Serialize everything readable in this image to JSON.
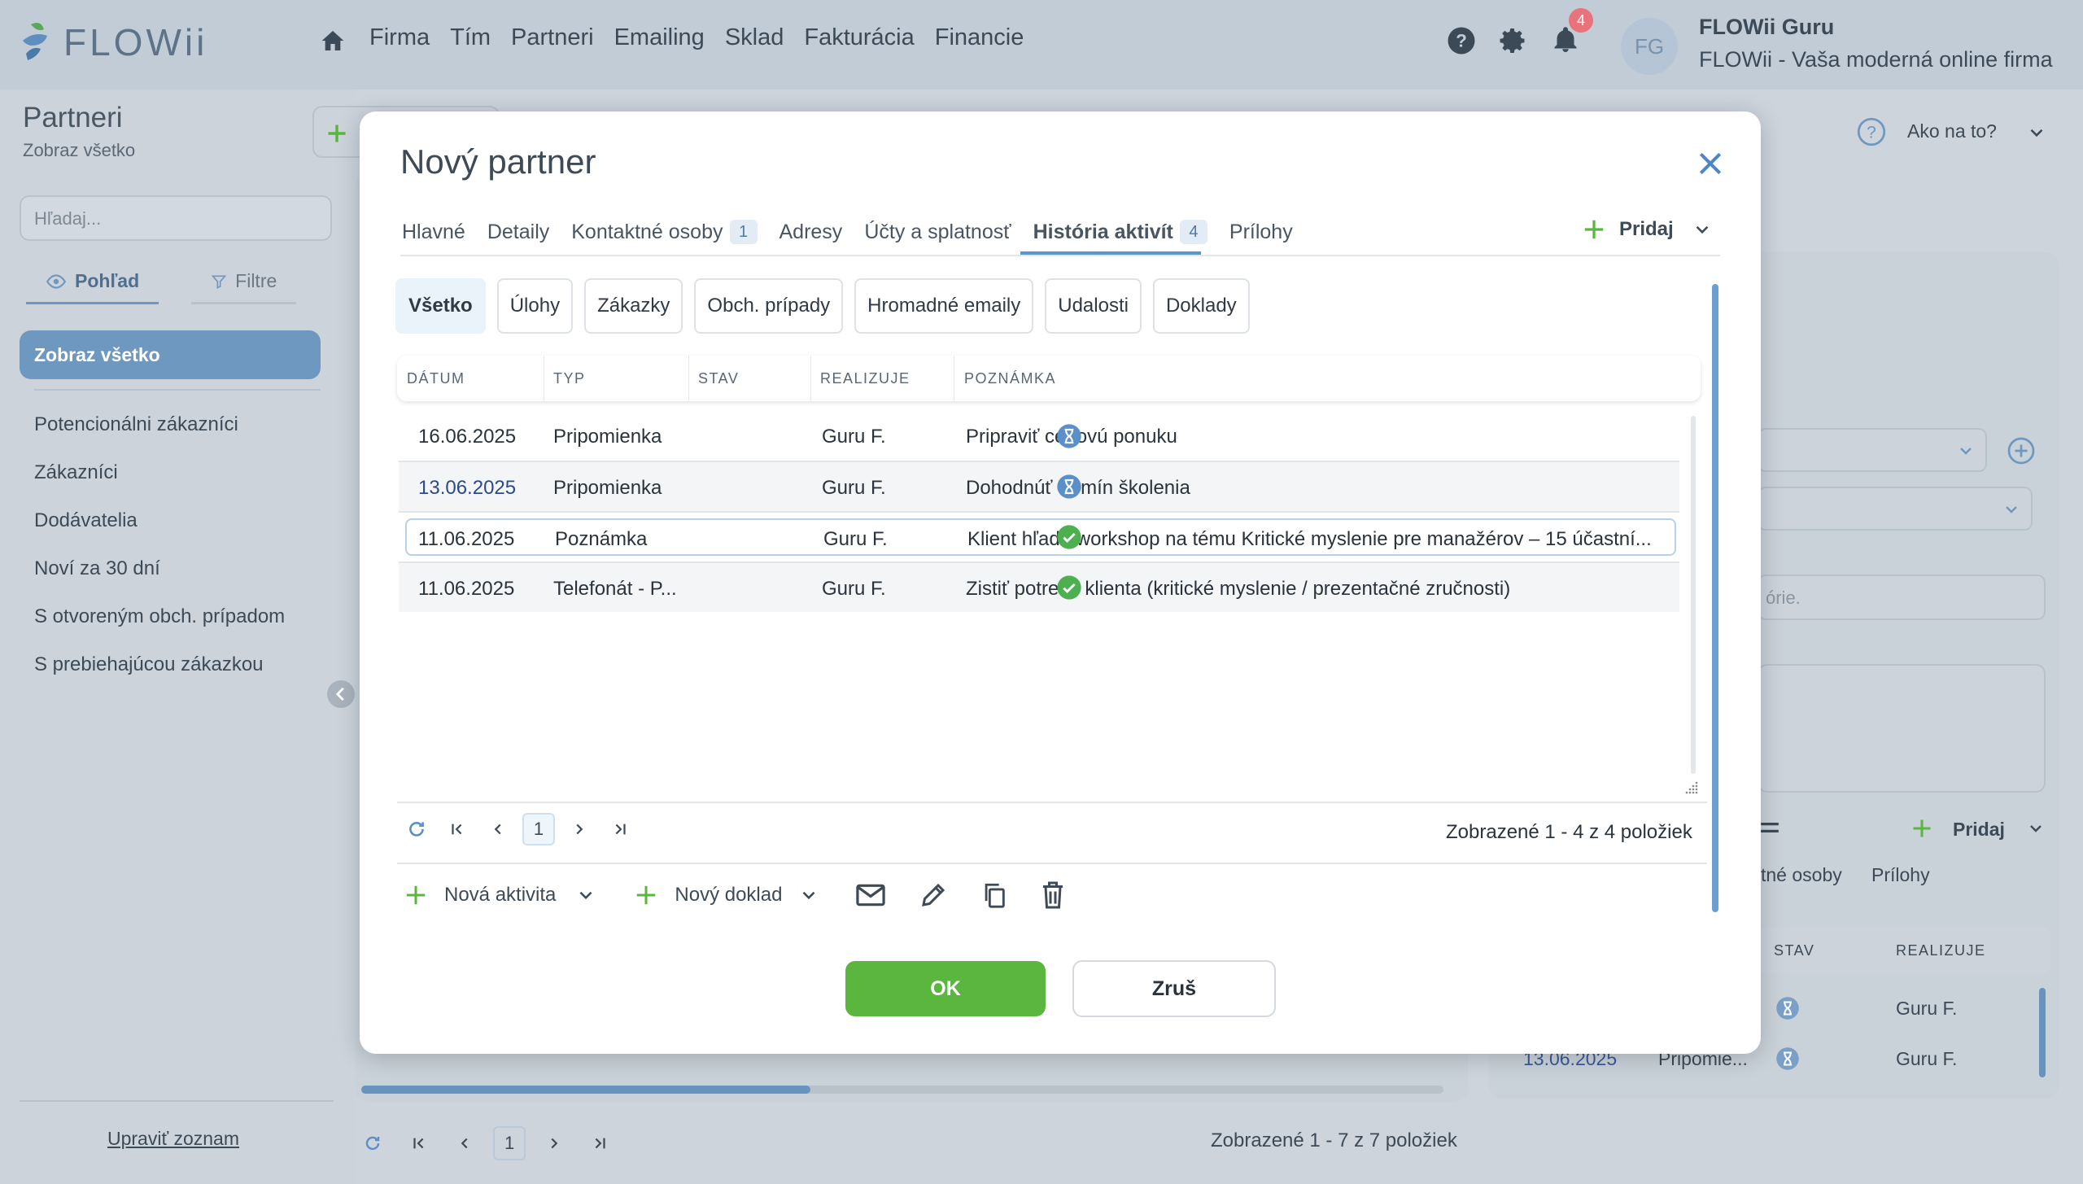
{
  "header": {
    "logo_text": "FLOWii",
    "nav": [
      "Firma",
      "Tím",
      "Partneri",
      "Emailing",
      "Sklad",
      "Fakturácia",
      "Financie"
    ],
    "notification_count": "4",
    "avatar_initials": "FG",
    "user_name": "FLOWii Guru",
    "company": "FLOWii - Vaša moderná online firma"
  },
  "sidebar": {
    "title": "Partneri",
    "subtitle": "Zobraz všetko",
    "search_placeholder": "Hľadaj...",
    "tab_view": "Pohľad",
    "tab_filters": "Filtre",
    "selected": "Zobraz všetko",
    "items": [
      "Potencionálni zákazníci",
      "Zákazníci",
      "Dodávatelia",
      "Noví za 30 dní",
      "S otvoreným obch. prípadom",
      "S prebiehajúcou zákazkou"
    ],
    "edit_link": "Upraviť zoznam"
  },
  "background": {
    "help_label": "Ako na to?",
    "pager_page": "1",
    "status": "Zobrazené 1 - 7 z 7 položiek",
    "right_panel": {
      "search_placeholder_fragment": "órie.",
      "pridaj": "Pridaj",
      "tab_fragment": "tné osoby",
      "tab_attachments": "Prílohy",
      "col_stav": "STAV",
      "col_realizuje": "REALIZUJE",
      "row1_realizuje": "Guru F.",
      "row2_date": "13.06.2025",
      "row2_type": "Pripomie...",
      "row2_realizuje": "Guru F."
    }
  },
  "modal": {
    "title": "Nový partner",
    "tabs": [
      {
        "label": "Hlavné",
        "count": ""
      },
      {
        "label": "Detaily",
        "count": ""
      },
      {
        "label": "Kontaktné osoby",
        "count": "1"
      },
      {
        "label": "Adresy",
        "count": ""
      },
      {
        "label": "Účty a splatnosť",
        "count": ""
      },
      {
        "label": "História aktivít",
        "count": "4"
      },
      {
        "label": "Prílohy",
        "count": ""
      }
    ],
    "active_tab": "História aktivít",
    "pridaj_label": "Pridaj",
    "filters": [
      "Všetko",
      "Úlohy",
      "Zákazky",
      "Obch. prípady",
      "Hromadné emaily",
      "Udalosti",
      "Doklady"
    ],
    "active_filter": "Všetko",
    "columns": [
      "DÁTUM",
      "TYP",
      "STAV",
      "REALIZUJE",
      "POZNÁMKA"
    ],
    "rows": [
      {
        "date": "16.06.2025",
        "type": "Pripomienka",
        "status": "pending",
        "by": "Guru F.",
        "note": "Pripraviť cenovú ponuku"
      },
      {
        "date": "13.06.2025",
        "type": "Pripomienka",
        "status": "pending",
        "by": "Guru F.",
        "note": "Dohodnúť termín školenia"
      },
      {
        "date": "11.06.2025",
        "type": "Poznámka",
        "status": "done",
        "by": "Guru F.",
        "note": "Klient hľadá workshop na tému Kritické myslenie pre manažérov – 15 účastní..."
      },
      {
        "date": "11.06.2025",
        "type": "Telefonát - P...",
        "status": "done",
        "by": "Guru F.",
        "note": "Zistiť potreby klienta (kritické myslenie / prezentačné zručnosti)"
      }
    ],
    "pager_page": "1",
    "pager_info": "Zobrazené 1 - 4 z 4 položiek",
    "new_activity": "Nová aktivita",
    "new_document": "Nový doklad",
    "ok_label": "OK",
    "cancel_label": "Zruš"
  },
  "colors": {
    "accent": "#5b95cc",
    "ok_green": "#5ab63e",
    "pending_blue": "#5b8fc8",
    "done_green": "#4caf50"
  }
}
